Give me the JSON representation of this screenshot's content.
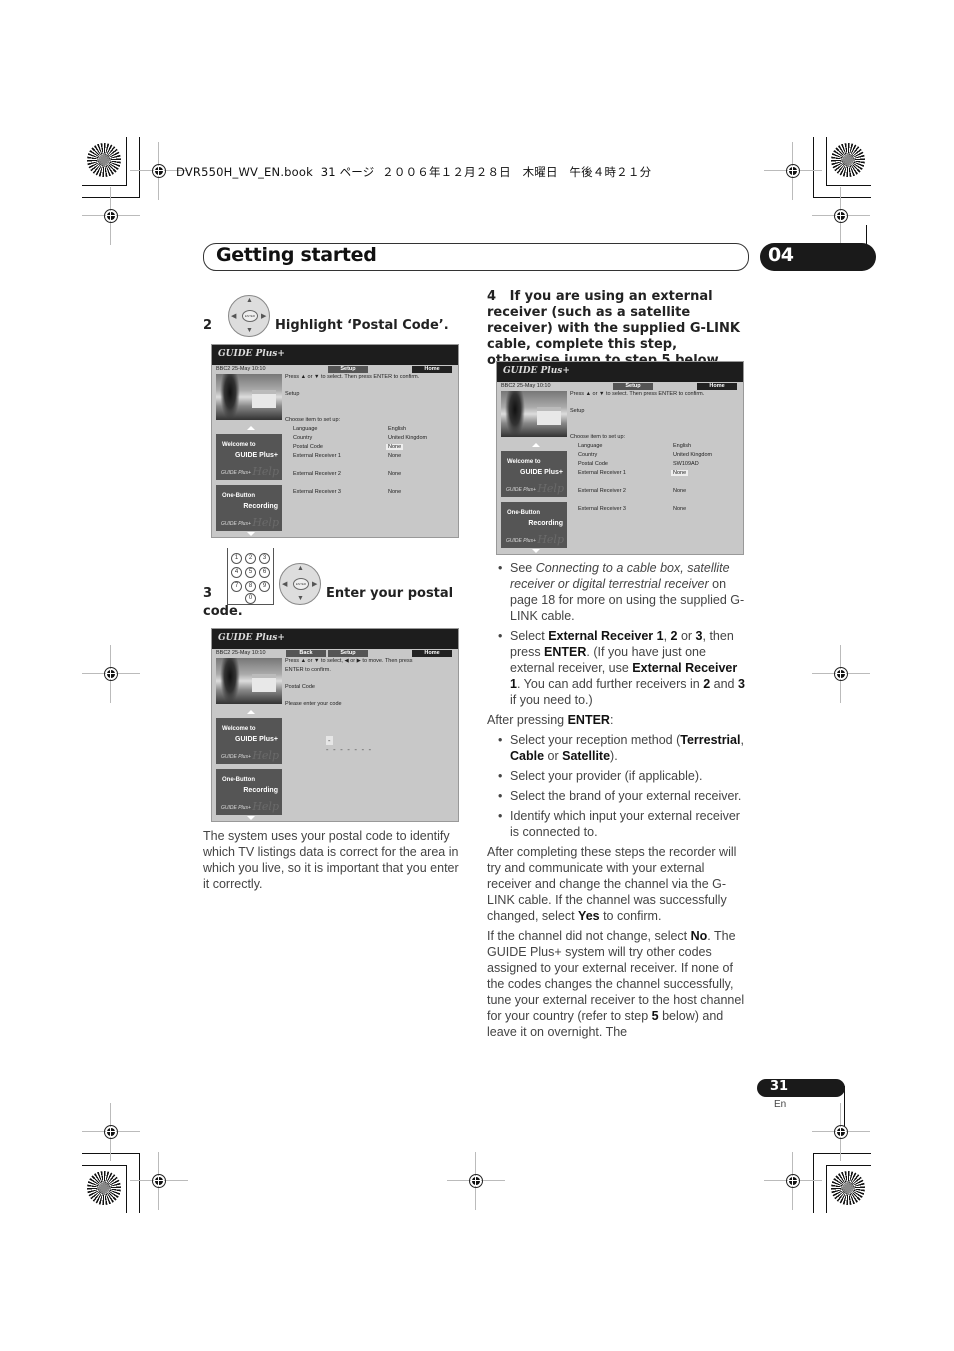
{
  "print_header": "DVR550H_WV_EN.book  31 ページ  ２００６年１２月２８日　木曜日　午後４時２１分",
  "chapter": {
    "title": "Getting started",
    "number": "04"
  },
  "step2": {
    "number": "2",
    "heading": "Highlight ‘Postal Code’.",
    "remote_icon": "dpad-enter-icon",
    "enter_label": "ENTER",
    "screen": {
      "logo": "GUIDE Plus+",
      "channel_info": "BBC2   25-May   10:10",
      "tabs": [
        "Setup",
        "Home"
      ],
      "instruction": "Press ▲ or ▼ to select. Then press ENTER to confirm.",
      "section": "Setup",
      "prompt": "Choose item to set up:",
      "items": [
        {
          "label": "Language",
          "value": "English"
        },
        {
          "label": "Country",
          "value": "United Kingdom"
        },
        {
          "label": "Postal Code",
          "value": "None"
        },
        {
          "label": "External Receiver 1",
          "value": "None"
        },
        {
          "label": "External Receiver 2",
          "value": "None"
        },
        {
          "label": "External Receiver 3",
          "value": "None"
        }
      ],
      "panels": [
        {
          "line1": "Welcome to",
          "line2": "GUIDE Plus+",
          "logo": "GUIDE Plus+",
          "help": "Help"
        },
        {
          "line1": "One-Button",
          "line2": "Recording",
          "logo": "GUIDE Plus+",
          "help": "Help"
        }
      ]
    }
  },
  "step3": {
    "number": "3",
    "heading": "Enter your postal code.",
    "heading_a": "Enter your postal",
    "heading_b": "code.",
    "keypad": [
      "1",
      "2",
      "3",
      "4",
      "5",
      "6",
      "7",
      "8",
      "9",
      "0"
    ],
    "screen": {
      "logo": "GUIDE Plus+",
      "channel_info": "BBC2   25-May   10:10",
      "tabs": [
        "Back",
        "Setup",
        "Home"
      ],
      "instruction_1": "Press ▲ or ▼ to select, ◀ or ▶ to move. Then press",
      "instruction_2": "ENTER to confirm.",
      "section": "Postal Code",
      "prompt": "Please enter your code",
      "code_entry": "-  -  -  -  -  -  -",
      "panels": [
        {
          "line1": "Welcome to",
          "line2": "GUIDE Plus+",
          "logo": "GUIDE Plus+",
          "help": "Help"
        },
        {
          "line1": "One-Button",
          "line2": "Recording",
          "logo": "GUIDE Plus+",
          "help": "Help"
        }
      ]
    },
    "note": "The system uses your postal code to identify which TV listings data is correct for the area in which you live, so it is important that you enter it correctly."
  },
  "step4": {
    "number": "4",
    "heading": "If you are using an external receiver (such as a satellite receiver) with the supplied G-LINK cable, complete this step, otherwise jump to step 5 below.",
    "screen": {
      "logo": "GUIDE Plus+",
      "channel_info": "BBC2   25-May   10:10",
      "tabs": [
        "Setup",
        "Home"
      ],
      "instruction": "Press ▲ or ▼ to select. Then press ENTER to confirm.",
      "section": "Setup",
      "prompt": "Choose item to set up:",
      "items": [
        {
          "label": "Language",
          "value": "English"
        },
        {
          "label": "Country",
          "value": "United Kingdom"
        },
        {
          "label": "Postal Code",
          "value": "SW109AD"
        },
        {
          "label": "External Receiver 1",
          "value": "None"
        },
        {
          "label": "External Receiver 2",
          "value": "None"
        },
        {
          "label": "External Receiver 3",
          "value": "None"
        }
      ],
      "panels": [
        {
          "line1": "Welcome to",
          "line2": "GUIDE Plus+",
          "logo": "GUIDE Plus+",
          "help": "Help"
        },
        {
          "line1": "One-Button",
          "line2": "Recording",
          "logo": "GUIDE Plus+",
          "help": "Help"
        }
      ]
    },
    "bullets": {
      "see_prefix": "See ",
      "see_link": "Connecting to a cable box, satellite receiver or digital terrestrial receiver",
      "see_suffix": " on page 18 for more on using the supplied G-LINK cable.",
      "select_text": "Select <b>External Receiver 1</b>, <b>2</b> or <b>3</b>, then press <b>ENTER</b>. (If you have just one external receiver, use <b>External Receiver 1</b>. You can add further receivers in <b>2</b> and <b>3</b> if you need to.)"
    },
    "after_enter_label": "After pressing <b>ENTER</b>:",
    "after_enter_items": [
      "Select your reception method (<b>Terrestrial</b>, <b>Cable</b> or <b>Satellite</b>).",
      "Select your provider (if applicable).",
      "Select the brand of your external receiver.",
      "Identify which input your external receiver is connected to."
    ],
    "para1": "After completing these steps the recorder will try and communicate with your external receiver and change the channel via the G-LINK cable. If the channel was successfully changed, select <b>Yes</b> to confirm.",
    "para2": "If the channel did not change, select <b>No</b>. The GUIDE Plus+ system will try other codes assigned to your external receiver. If none of the codes changes the channel successfully, tune your external receiver to the host channel for your country (refer to step <b>5</b> below) and leave it on overnight. The"
  },
  "footer": {
    "page_number": "31",
    "language": "En"
  }
}
